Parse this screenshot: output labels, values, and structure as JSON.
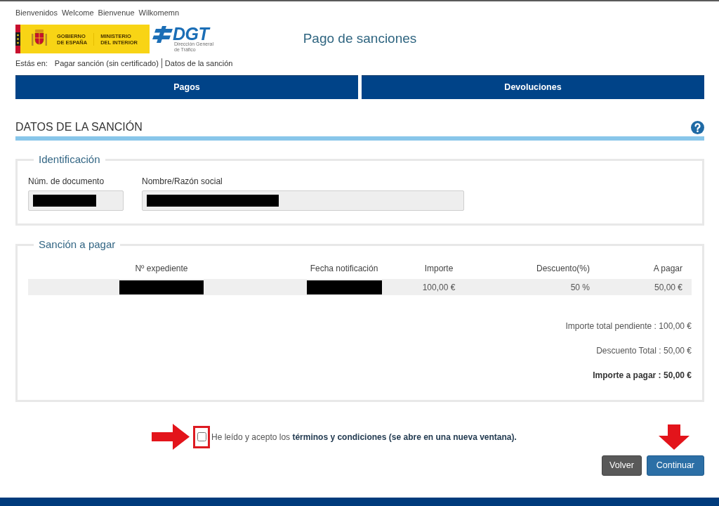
{
  "language_links": [
    "Bienvenidos",
    "Welcome",
    "Bienvenue",
    "Wilkomemn"
  ],
  "header": {
    "government_logo": {
      "captions": [
        {
          "lines": [
            "GOBIERNO",
            "DE ESPAÑA"
          ]
        },
        {
          "lines": [
            "MINISTERIO",
            "DEL INTERIOR"
          ]
        }
      ]
    },
    "dgt_logo": {
      "name": "DGT",
      "subtitle_lines": [
        "Dirección General",
        "de Tráfico"
      ]
    },
    "title": "Pago de sanciones"
  },
  "breadcrumb": {
    "label": "Estás en:",
    "items": [
      "Pagar sanción (sin certificado)",
      "Datos de la sanción"
    ]
  },
  "nav": [
    {
      "label": "Pagos"
    },
    {
      "label": "Devoluciones"
    }
  ],
  "section": {
    "title": "DATOS DE LA SANCIÓN"
  },
  "identification": {
    "legend": "Identificación",
    "fields": [
      {
        "label": "Núm. de documento",
        "redacted": true
      },
      {
        "label": "Nombre/Razón social",
        "redacted": true
      }
    ]
  },
  "sanction": {
    "legend": "Sanción a pagar",
    "columns": [
      "Nº expediente",
      "Fecha notificación",
      "Importe",
      "Descuento(%)",
      "A pagar"
    ],
    "rows": [
      {
        "cells": [
          {
            "redacted": true
          },
          {
            "redacted": true
          },
          {
            "text": "100,00 €"
          },
          {
            "text": "50 %"
          },
          {
            "text": "50,00 €"
          }
        ]
      }
    ],
    "totals": [
      {
        "text": "Importe total pendiente : 100,00 €",
        "strong": false
      },
      {
        "text": "Descuento Total : 50,00 €",
        "strong": false
      },
      {
        "text": "Importe a pagar : 50,00 €",
        "strong": true
      }
    ]
  },
  "agreement": {
    "text": "He leído y acepto los",
    "link": "términos y condiciones (se abre en una nueva ventana).",
    "checked": false
  },
  "buttons": [
    {
      "label": "Volver",
      "kind": "secondary"
    },
    {
      "label": "Continuar",
      "kind": "primary"
    }
  ]
}
